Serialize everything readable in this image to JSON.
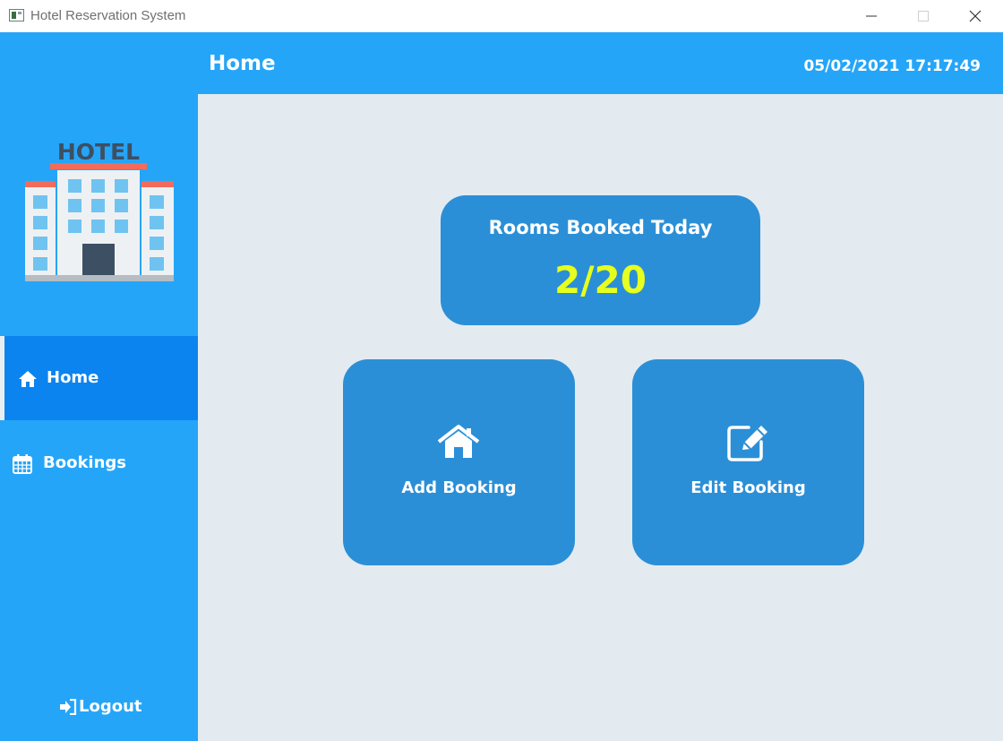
{
  "window": {
    "title": "Hotel Reservation System",
    "icon": "app-window-icon"
  },
  "header": {
    "title": "Home",
    "datetime": "05/02/2021 17:17:49"
  },
  "sidebar": {
    "logo_text": "HOTEL",
    "items": [
      {
        "label": "Home",
        "icon": "home-icon",
        "active": true
      },
      {
        "label": "Bookings",
        "icon": "calendar-icon",
        "active": false
      }
    ],
    "logout_label": "Logout",
    "logout_icon": "sign-out-icon"
  },
  "stats": {
    "label": "Rooms Booked Today",
    "value": "2/20"
  },
  "actions": [
    {
      "label": "Add Booking",
      "icon": "home-icon"
    },
    {
      "label": "Edit Booking",
      "icon": "edit-icon"
    }
  ],
  "colors": {
    "accent": "#25a5f8",
    "active_nav": "#0c84ef",
    "card": "#2b8fd7",
    "background": "#e3ebf0",
    "stat_value": "#e6ff1e"
  }
}
